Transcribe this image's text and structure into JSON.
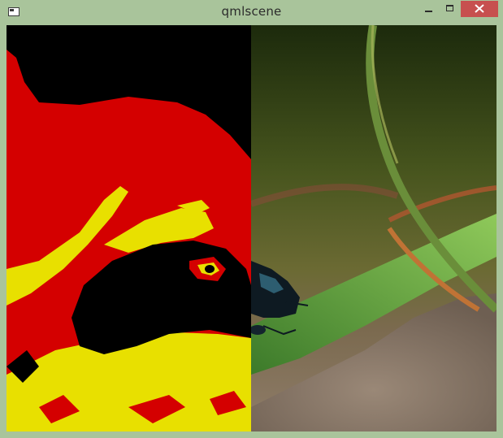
{
  "window": {
    "title": "qmlscene",
    "icon": "app-window-icon"
  },
  "controls": {
    "minimize": "minimize-icon",
    "maximize": "maximize-icon",
    "close": "close-icon"
  },
  "content": {
    "left_pane": "posterized-shader-view",
    "right_pane": "original-image-view"
  },
  "colors": {
    "titlebar_bg": "#a9c49b",
    "close_bg": "#c7504f",
    "poster_red": "#d40000",
    "poster_yellow": "#e8e000",
    "poster_black": "#000000"
  }
}
